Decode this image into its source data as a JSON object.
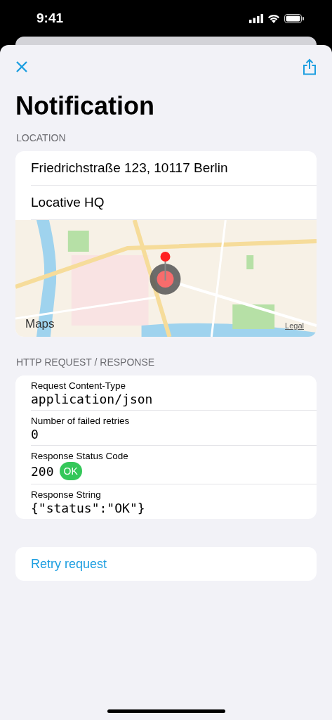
{
  "status_bar": {
    "time": "9:41"
  },
  "title": "Notification",
  "location": {
    "header": "LOCATION",
    "rows": [
      "Friedrichstraße 123, 10117 Berlin",
      "Locative HQ"
    ],
    "map": {
      "kind": "picture",
      "logo": "Maps",
      "legal": "Legal"
    }
  },
  "http": {
    "header": "HTTP REQUEST / RESPONSE",
    "fields": [
      {
        "label": "Request Content-Type",
        "value": "application/json"
      },
      {
        "label": "Number of failed retries",
        "value": "0"
      },
      {
        "label": "Response Status Code",
        "value": "200",
        "badge": {
          "text": "OK",
          "color": "#34c759"
        }
      },
      {
        "label": "Response String",
        "value": "{\"status\":\"OK\"}"
      }
    ]
  },
  "actions": [
    {
      "label": "Retry request"
    }
  ]
}
